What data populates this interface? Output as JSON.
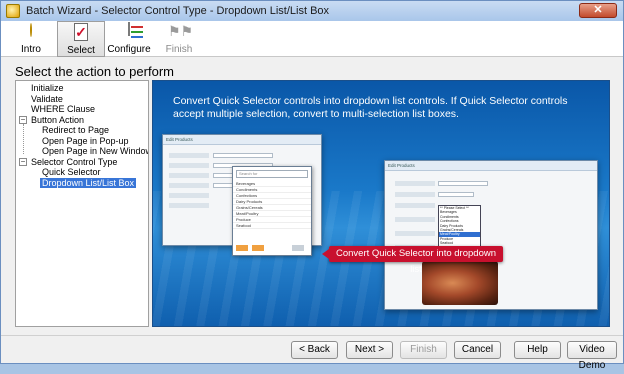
{
  "window": {
    "title": "Batch Wizard - Selector Control Type - Dropdown List/List Box",
    "close_glyph": "✕"
  },
  "steps": [
    {
      "label": "Intro",
      "icon": "lightbulb-icon"
    },
    {
      "label": "Select",
      "icon": "checkbox-icon"
    },
    {
      "label": "Configure",
      "icon": "configure-icon"
    },
    {
      "label": "Finish",
      "icon": "checkered-flag-icon"
    }
  ],
  "page": {
    "heading": "Select the action to perform"
  },
  "tree": {
    "items": [
      {
        "label": "Initialize",
        "level": 0
      },
      {
        "label": "Validate",
        "level": 0
      },
      {
        "label": "WHERE Clause",
        "level": 0
      },
      {
        "label": "Button Action",
        "level": 0,
        "expander": "−"
      },
      {
        "label": "Redirect to Page",
        "level": 1
      },
      {
        "label": "Open Page in Pop-up",
        "level": 1
      },
      {
        "label": "Open Page in New Window",
        "level": 1
      },
      {
        "label": "Selector Control Type",
        "level": 0,
        "expander": "−"
      },
      {
        "label": "Quick Selector",
        "level": 1
      },
      {
        "label": "Dropdown List/List Box",
        "level": 1,
        "selected": true
      }
    ]
  },
  "demo": {
    "description": "Convert Quick Selector controls into dropdown list controls.  If Quick Selector controls accept multiple selection, convert to multi-selection list boxes.",
    "callout": "Convert Quick Selector into dropdown list",
    "left_shot": {
      "header": "Edit Products",
      "search_placeholder": "Search for",
      "items": [
        "Beverages",
        "Condiments",
        "Confections",
        "Dairy Products",
        "Grains/Cereals",
        "Meat/Poultry",
        "Produce",
        "Seafood"
      ]
    },
    "right_shot": {
      "header": "Edit Products",
      "dropdown_items": [
        "** Please Select **",
        "Beverages",
        "Condiments",
        "Confections",
        "Dairy Products",
        "Grains/Cereals",
        "Meat/Poultry",
        "Produce",
        "Seafood"
      ],
      "dropdown_selected": "Meat/Poultry"
    }
  },
  "buttons": {
    "back": "< Back",
    "next": "Next >",
    "finish": "Finish",
    "cancel": "Cancel",
    "help": "Help",
    "video": "Video Demo"
  },
  "colors": {
    "selection": "#3875d7",
    "callout": "#c8102e",
    "demo_bg": "#1a79c9"
  }
}
